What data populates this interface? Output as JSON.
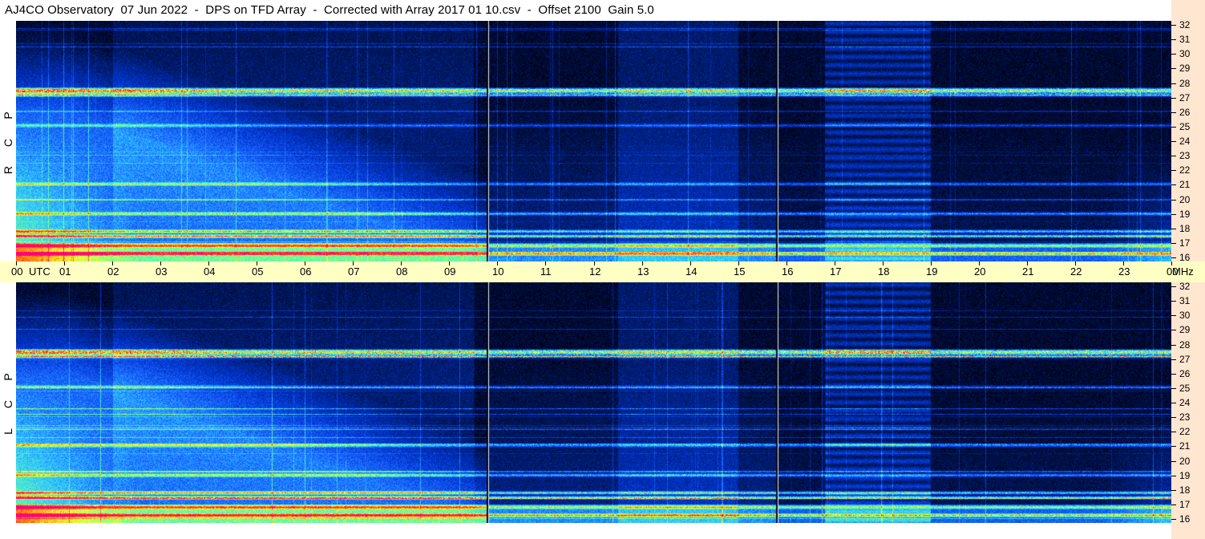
{
  "title": "AJ4CO Observatory  07 Jun 2022  -  DPS on TFD Array  -  Corrected with Array 2017 01 10.csv  -  Offset 2100  Gain 5.0",
  "chart_data": {
    "type": "heatmap",
    "title": "AJ4CO Observatory  07 Jun 2022  -  DPS on TFD Array  -  Corrected with Array 2017 01 10.csv  -  Offset 2100  Gain 5.0",
    "x_unit": "UTC",
    "y_unit": "MHz",
    "xlim": [
      0,
      24
    ],
    "ylim": [
      16,
      32
    ],
    "time_ticks": [
      "00",
      "UTC",
      "01",
      "02",
      "03",
      "04",
      "05",
      "06",
      "07",
      "08",
      "09",
      "10",
      "11",
      "12",
      "13",
      "14",
      "15",
      "16",
      "17",
      "18",
      "19",
      "20",
      "21",
      "22",
      "23",
      "00",
      "MHz"
    ],
    "freq_ticks": [
      "32",
      "31",
      "30",
      "29",
      "28",
      "27",
      "26",
      "25",
      "24",
      "23",
      "22",
      "21",
      "20",
      "19",
      "18",
      "17",
      "16"
    ],
    "panels": [
      {
        "name": "RCP",
        "letters": [
          "R",
          "C",
          "P"
        ]
      },
      {
        "name": "LCP",
        "letters": [
          "L",
          "C",
          "P"
        ]
      }
    ],
    "data_gaps_utc": [
      9.8,
      15.8
    ],
    "colormap": [
      "#000010",
      "#001a66",
      "#0033cc",
      "#1a66ff",
      "#33ccff",
      "#66ff99",
      "#ffff33",
      "#ff6600",
      "#ff0080"
    ]
  }
}
